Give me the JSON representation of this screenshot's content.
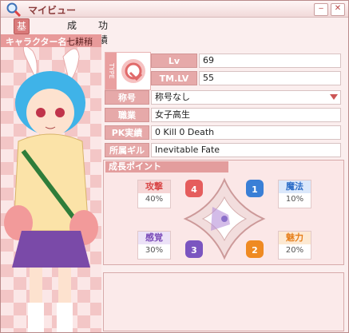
{
  "window": {
    "title": "マイビュー",
    "minimize_label": "‒",
    "close_label": "✕"
  },
  "tabs": [
    {
      "label": "基本情報",
      "active": true
    },
    {
      "label": "成長",
      "active": false
    },
    {
      "label": "功績",
      "active": false
    }
  ],
  "character": {
    "label": "キャラクター名",
    "name": "七耕稍"
  },
  "profile": {
    "type_tag": "TYPE",
    "lv_label": "Lv",
    "lv_value": "69",
    "tmlv_label": "TM.LV",
    "tmlv_value": "55",
    "title_label": "称号",
    "title_value": "称号なし",
    "job_label": "職業",
    "job_value": "女子高生",
    "pk_label": "PK実績",
    "pk_value": "0 Kill  0 Death",
    "guild_label": "所属ギルド",
    "guild_value": "Inevitable Fate"
  },
  "growth": {
    "header": "成長ポイント",
    "stats": [
      {
        "name": "攻撃",
        "value": "40%",
        "color": "#d94a4a",
        "bg": "#f6d6d6",
        "num": "4"
      },
      {
        "name": "魔法",
        "value": "10%",
        "color": "#2f6fc8",
        "bg": "#dbe8fb",
        "num": "1"
      },
      {
        "name": "感覚",
        "value": "30%",
        "color": "#7a4bb8",
        "bg": "#ece2f7",
        "num": "3"
      },
      {
        "name": "魅力",
        "value": "20%",
        "color": "#e67f1a",
        "bg": "#fde9d2",
        "num": "2"
      }
    ]
  },
  "colors": {
    "accent": "#d97a7a",
    "panel_bg": "#fbe7e7"
  }
}
